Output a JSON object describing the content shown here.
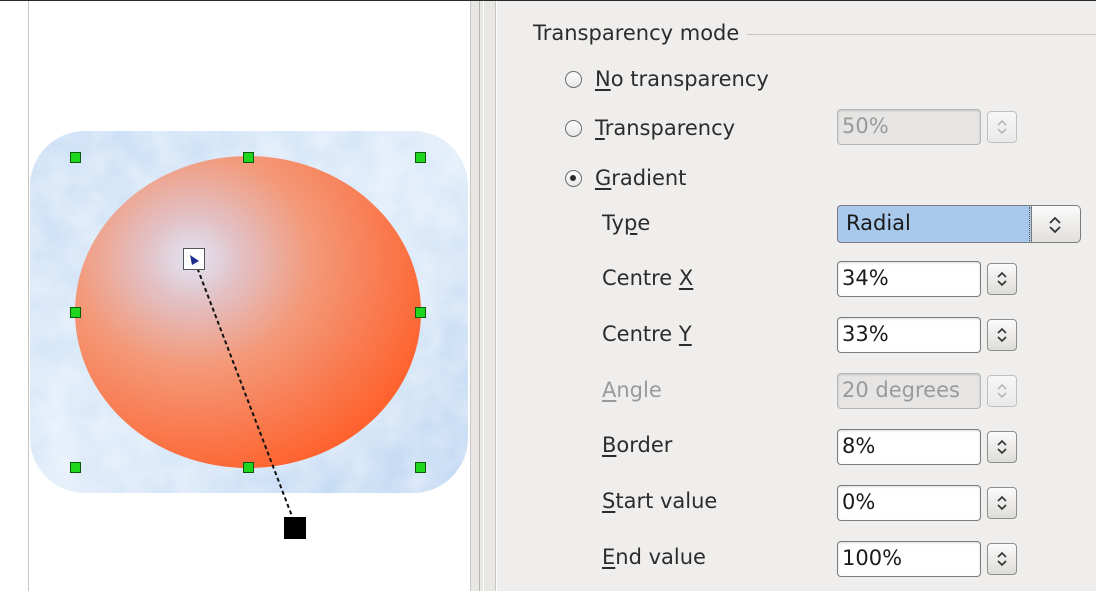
{
  "colors": {
    "panel_bg": "#efeeec",
    "selected_item_bg": "#a9c9ec",
    "handle_color": "#1fd61f",
    "circle_color": "#fe6a3a"
  },
  "transparency": {
    "section_title": "Transparency mode",
    "options": [
      {
        "label_mnemonic": "N",
        "label_rest": "o transparency",
        "checked": false
      },
      {
        "label_mnemonic": "T",
        "label_rest": "ransparency",
        "checked": false,
        "value": "50%",
        "value_disabled": true
      },
      {
        "label_mnemonic": "G",
        "label_rest": "radient",
        "checked": true
      }
    ]
  },
  "gradient": {
    "type": {
      "label_pre": "Ty",
      "label_mnemonic": "p",
      "label_post": "e",
      "value": "Radial"
    },
    "centre_x": {
      "label_pre": "Centre ",
      "label_mnemonic": "X",
      "value": "34%"
    },
    "centre_y": {
      "label_pre": "Centre ",
      "label_mnemonic": "Y",
      "value": "33%"
    },
    "angle": {
      "label_mnemonic": "A",
      "label_post": "ngle",
      "value": "20 degrees",
      "disabled": true
    },
    "border": {
      "label_mnemonic": "B",
      "label_post": "order",
      "value": "8%"
    },
    "start_value": {
      "label_mnemonic": "S",
      "label_post": "tart value",
      "value": "0%"
    },
    "end_value": {
      "label_mnemonic": "E",
      "label_post": "nd value",
      "value": "100%"
    }
  },
  "preview": {
    "icons": [
      "selection-handle-icon",
      "gradient-center-handle-icon",
      "gradient-end-handle-icon",
      "spin-arrows-icon",
      "dropdown-arrows-icon"
    ]
  }
}
